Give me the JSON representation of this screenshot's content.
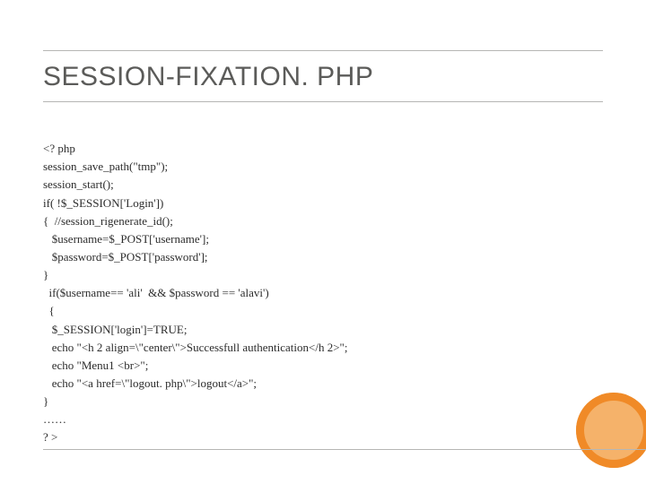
{
  "title": "SESSION-FIXATION. PHP",
  "code_lines": [
    "<? php",
    "session_save_path(\"tmp\");",
    "session_start();",
    "if( !$_SESSION['Login'])",
    "{  //session_rigenerate_id();",
    "   $username=$_POST['username'];",
    "   $password=$_POST['password'];",
    "}",
    "  if($username== 'ali'  && $password == 'alavi')",
    "  {",
    "   $_SESSION['login']=TRUE;",
    "   echo \"<h 2 align=\\\"center\\\">Successfull authentication</h 2>\";",
    "   echo \"Menu1 <br>\";",
    "   echo \"<a href=\\\"logout. php\\\">logout</a>\";",
    "}",
    "……",
    "? >"
  ]
}
